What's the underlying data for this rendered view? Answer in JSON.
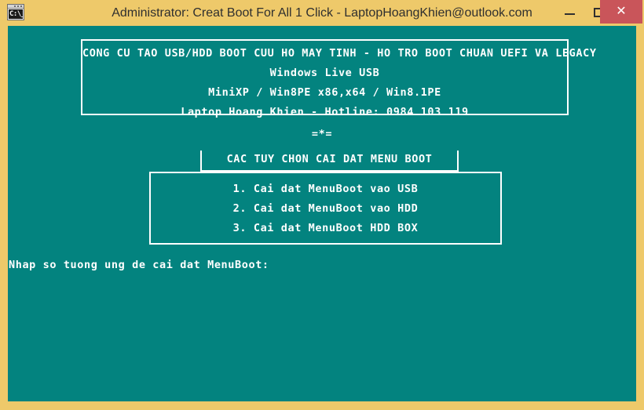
{
  "window": {
    "title": "Administrator:  Creat Boot For All  1 Click - LaptopHoangKhien@outlook.com",
    "icon_name": "cmd-console-icon",
    "icon_glyph": "C:\\_",
    "chrome_color": "#eec96a",
    "console_bg_color": "#03837f",
    "console_fg_color": "#ffffff",
    "close_button_color": "#c9555a"
  },
  "titlebar_buttons": {
    "minimize_label": "–",
    "maximize_label": "□",
    "close_label": "✕"
  },
  "console": {
    "header_box": {
      "lines": [
        "CONG CU TAO USB/HDD BOOT CUU HO MAY TINH - HO TRO BOOT CHUAN UEFI VA LEGACY",
        "Windows Live USB",
        "MiniXP / Win8PE x86,x64 / Win8.1PE",
        "Laptop Hoang Khien - Hotline: 0984 103 119"
      ]
    },
    "separator": "=*=",
    "menu_title": "CAC TUY CHON CAI DAT MENU BOOT",
    "options": [
      "1. Cai dat MenuBoot vao USB",
      "2. Cai dat MenuBoot vao HDD",
      "3. Cai dat MenuBoot HDD BOX"
    ],
    "prompt": "Nhap so tuong ung de cai dat MenuBoot:"
  }
}
